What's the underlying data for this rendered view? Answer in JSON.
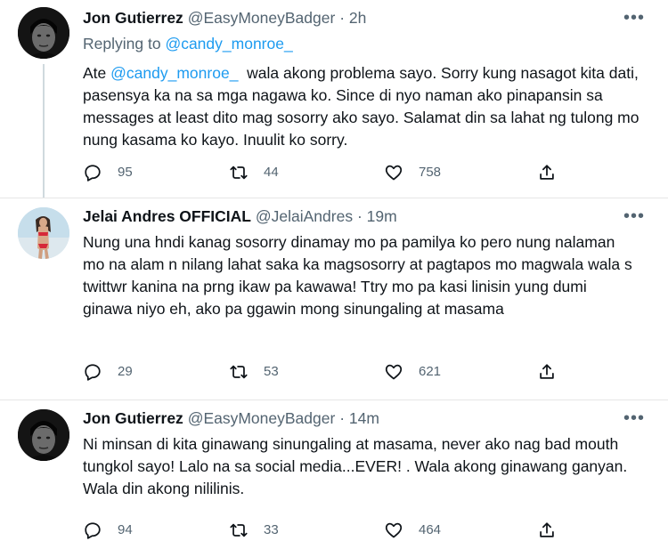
{
  "tweets": [
    {
      "name": "Jon Gutierrez",
      "handle": "@EasyMoneyBadger",
      "separator": "·",
      "time": "2h",
      "replying_prefix": "Replying to",
      "replying_to": "@candy_monroe_",
      "body_prefix": "Ate",
      "body_mention": "@candy_monroe_",
      "body_rest": "  wala akong problema sayo. Sorry kung nasagot kita dati, pasensya ka na sa mga nagawa ko. Since di nyo naman ako pinapansin sa messages at least dito mag sosorry ako sayo. Salamat din sa lahat ng tulong mo nung kasama ko kayo. Inuulit ko sorry.",
      "replies": "95",
      "retweets": "44",
      "likes": "758",
      "more": "•••"
    },
    {
      "name": "Jelai Andres OFFICIAL",
      "handle": "@JelaiAndres",
      "separator": "·",
      "time": "19m",
      "body": "Nung una hndi kanag sosorry dinamay mo pa pamilya ko pero nung nalaman mo na alam n nilang lahat saka ka magsosorry at pagtapos mo magwala wala s twittwr kanina na prng ikaw pa kawawa! Ttry mo pa kasi linisin yung dumi ginawa niyo eh, ako pa ggawin mong sinungaling at masama",
      "replies": "29",
      "retweets": "53",
      "likes": "621",
      "more": "•••"
    },
    {
      "name": "Jon Gutierrez",
      "handle": "@EasyMoneyBadger",
      "separator": "·",
      "time": "14m",
      "body": "Ni minsan di kita ginawang sinungaling at masama, never ako nag bad mouth tungkol sayo! Lalo na sa social media...EVER! . Wala akong ginawang ganyan. Wala din akong nililinis.",
      "replies": "94",
      "retweets": "33",
      "likes": "464",
      "more": "•••"
    }
  ],
  "icons": {
    "reply": "reply-icon",
    "retweet": "retweet-icon",
    "like": "heart-icon",
    "share": "share-icon",
    "more": "more-icon"
  },
  "colors": {
    "text": "#0f1419",
    "secondary": "#536471",
    "link": "#1d9bf0",
    "divider": "#e6e6e6"
  }
}
